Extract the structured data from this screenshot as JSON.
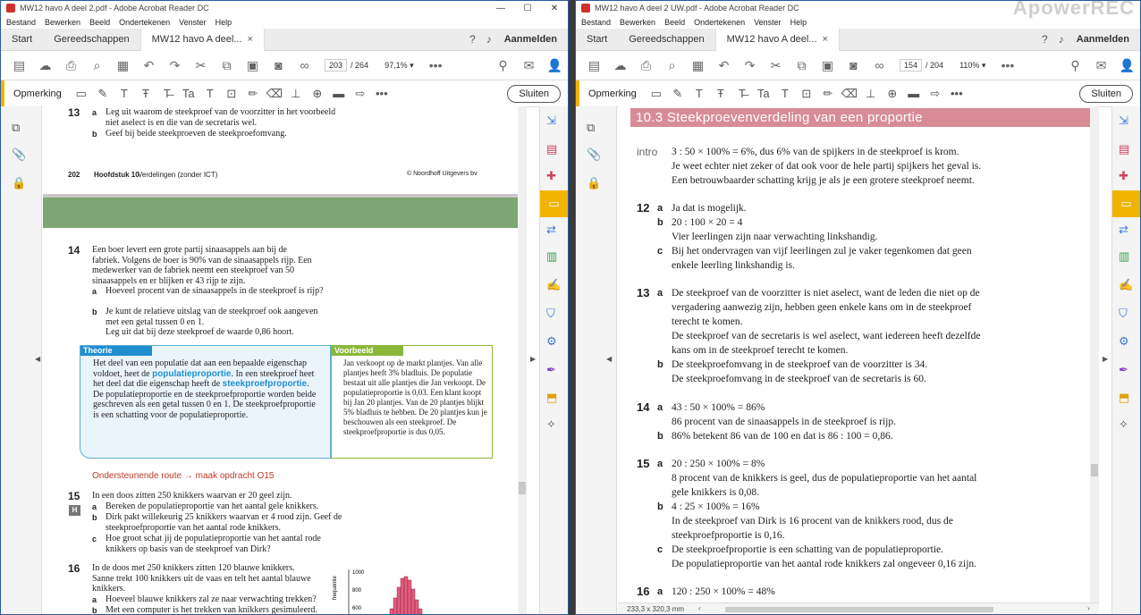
{
  "left": {
    "title": "MW12 havo A deel 2.pdf - Adobe Acrobat Reader DC",
    "menu": [
      "Bestand",
      "Bewerken",
      "Beeld",
      "Ondertekenen",
      "Venster",
      "Help"
    ],
    "tabs": {
      "start": "Start",
      "tools": "Gereedschappen",
      "doc": "MW12 havo A deel..."
    },
    "login": "Aanmelden",
    "page_current": "203",
    "page_total": "/ 264",
    "zoom": "97,1%",
    "comment_label": "Opmerking",
    "close_label": "Sluiten",
    "page_content": {
      "q13n": "13",
      "q13a": "a",
      "q13a_text": "Leg uit waarom de steekproef van de voorzitter in het voorbeeld niet aselect is en die van de secretaris wel.",
      "q13b": "b",
      "q13b_text": "Geef bij beide steekproeven de steekproefomvang.",
      "footer_page": "202",
      "footer_chapter": "Hoofdstuk 10",
      "footer_title": "Verdelingen (zonder ICT)",
      "footer_pub": "© Noordhoff Uitgevers bv",
      "q14n": "14",
      "q14_text": "Een boer levert een grote partij sinaasappels aan bij de fabriek. Volgens de boer is 90% van de sinaasappels rijp. Een medewerker van de fabriek neemt een steekproef van 50 sinaasappels en er blijken er 43 rijp te zijn.",
      "q14a": "a",
      "q14a_text": "Hoeveel procent van de sinaasappels in de steekproef is rijp?",
      "q14b": "b",
      "q14b_text": "Je kunt de relatieve uitslag van de steekproef ook aangeven met een getal tussen 0 en 1.",
      "q14b_text2": "Leg uit dat bij deze steekproef de waarde 0,86 hoort.",
      "theorie_head": "Theorie",
      "theorie_1": "Het deel van een populatie dat aan een bepaalde eigenschap voldoet, heet de ",
      "theorie_kw1": "populatieproportie",
      "theorie_2": ". In een steekproef heet het deel dat die eigenschap heeft de ",
      "theorie_kw2": "steekproefproportie",
      "theorie_3": ". De populatieproportie en de steekproefproportie worden beide geschreven als een getal tussen 0 en 1. De steekproefproportie is een schatting voor de populatieproportie.",
      "voorbeeld_head": "Voorbeeld",
      "voorbeeld_text": "Jan verkoopt op de markt plantjes. Van alle plantjes heeft 3% bladluis. De populatie bestaat uit alle plantjes die Jan verkoopt. De populatieproportie is 0,03. Een klant koopt bij Jan 20 plantjes. Van de 20 plantjes blijkt 5% bladluis te hebben. De 20 plantjes kun je beschouwen als een steekproef. De steekproefproportie is dus 0,05.",
      "route": "Ondersteunende route → maak opdracht O15",
      "q15n": "15",
      "q15_text": "In een doos zitten 250 knikkers waarvan er 20 geel zijn.",
      "q15_h": "H",
      "q15a": "a",
      "q15a_text": "Bereken de populatieproportie van het aantal gele knikkers.",
      "q15b": "b",
      "q15b_text": "Dirk pakt willekeurig 25 knikkers waarvan er 4 rood zijn. Geef de steekproefproportie van het aantal rode knikkers.",
      "q15c": "c",
      "q15c_text": "Hoe groot schat jij de populatieproportie van het aantal rode knikkers op basis van de steekproef van Dirk?",
      "q16n": "16",
      "q16_text": "In de doos met 250 knikkers zitten 120 blauwe knikkers. Sanne trekt 100 knikkers uit de vaas en telt het aantal blauwe knikkers.",
      "q16a": "a",
      "q16a_text": "Hoeveel blauwe knikkers zal ze naar verwachting trekken?",
      "q16b": "b",
      "q16b_text": "Met een computer is het trekken van knikkers gesimuleerd.",
      "hist_ylabel": "frequentie",
      "hist_t1": "1000",
      "hist_t2": "800",
      "hist_t3": "600"
    }
  },
  "right": {
    "title": "MW12 havo A deel 2 UW.pdf - Adobe Acrobat Reader DC",
    "watermark": "ApowerREC",
    "menu": [
      "Bestand",
      "Bewerken",
      "Beeld",
      "Ondertekenen",
      "Venster",
      "Help"
    ],
    "tabs": {
      "start": "Start",
      "tools": "Gereedschappen",
      "doc": "MW12 havo A deel..."
    },
    "login": "Aanmelden",
    "page_current": "154",
    "page_total": "/ 204",
    "zoom": "110%",
    "comment_label": "Opmerking",
    "close_label": "Sluiten",
    "status": "233,3 x 320,3 mm",
    "section_title": "10.3  Steekproevenverdeling van een proportie",
    "intro_label": "intro",
    "intro_1": "3 : 50 × 100% = 6%, dus 6% van de spijkers in de steekproef is krom.",
    "intro_2": "Je weet echter niet zeker of dat ook voor de hele partij spijkers het geval is.",
    "intro_3": "Een betrouwbaarder schatting krijg je als je een grotere steekproef neemt.",
    "a12n": "12",
    "a12a": "a",
    "a12a_1": "Ja dat is mogelijk.",
    "a12b": "b",
    "a12b_1": "20 : 100 × 20 = 4",
    "a12b_2": "Vier leerlingen zijn naar verwachting linkshandig.",
    "a12c": "c",
    "a12c_1": "Bij het ondervragen van vijf leerlingen zul je vaker tegenkomen dat geen",
    "a12c_2": "enkele leerling linkshandig is.",
    "a13n": "13",
    "a13a": "a",
    "a13a_1": "De steekproef van de voorzitter is niet aselect, want de leden die niet op de",
    "a13a_2": "vergadering aanwezig zijn, hebben geen enkele kans om in de steekproef",
    "a13a_3": "terecht te komen.",
    "a13a_4": "De steekproef van de secretaris is wel aselect, want iedereen heeft dezelfde",
    "a13a_5": "kans om in de steekproef terecht te komen.",
    "a13b": "b",
    "a13b_1": "De steekproefomvang in de steekproef van de voorzitter is 34.",
    "a13b_2": "De steekproefomvang in de steekproef van de secretaris is 60.",
    "a14n": "14",
    "a14a": "a",
    "a14a_1": "43 : 50 × 100% = 86%",
    "a14a_2": "86 procent van de sinaasappels in de steekproef is rijp.",
    "a14b": "b",
    "a14b_1": "86% betekent 86 van de 100 en dat is 86 : 100 = 0,86.",
    "a15n": "15",
    "a15a": "a",
    "a15a_1": "20 : 250 × 100% = 8%",
    "a15a_2": "8 procent van de knikkers is geel, dus de populatieproportie van het aantal",
    "a15a_3": "gele knikkers is 0,08.",
    "a15b": "b",
    "a15b_1": "4 : 25 × 100% = 16%",
    "a15b_2": "In de steekproef van Dirk is 16 procent van de knikkers rood, dus de",
    "a15b_3": "steekproefproportie is 0,16.",
    "a15c": "c",
    "a15c_1": "De steekproefproportie is een schatting van de populatieproportie.",
    "a15c_2": "De populatieproportie van het aantal rode knikkers zal ongeveer 0,16 zijn.",
    "a16n": "16",
    "a16a": "a",
    "a16a_1": "120 : 250 × 100% = 48%"
  }
}
